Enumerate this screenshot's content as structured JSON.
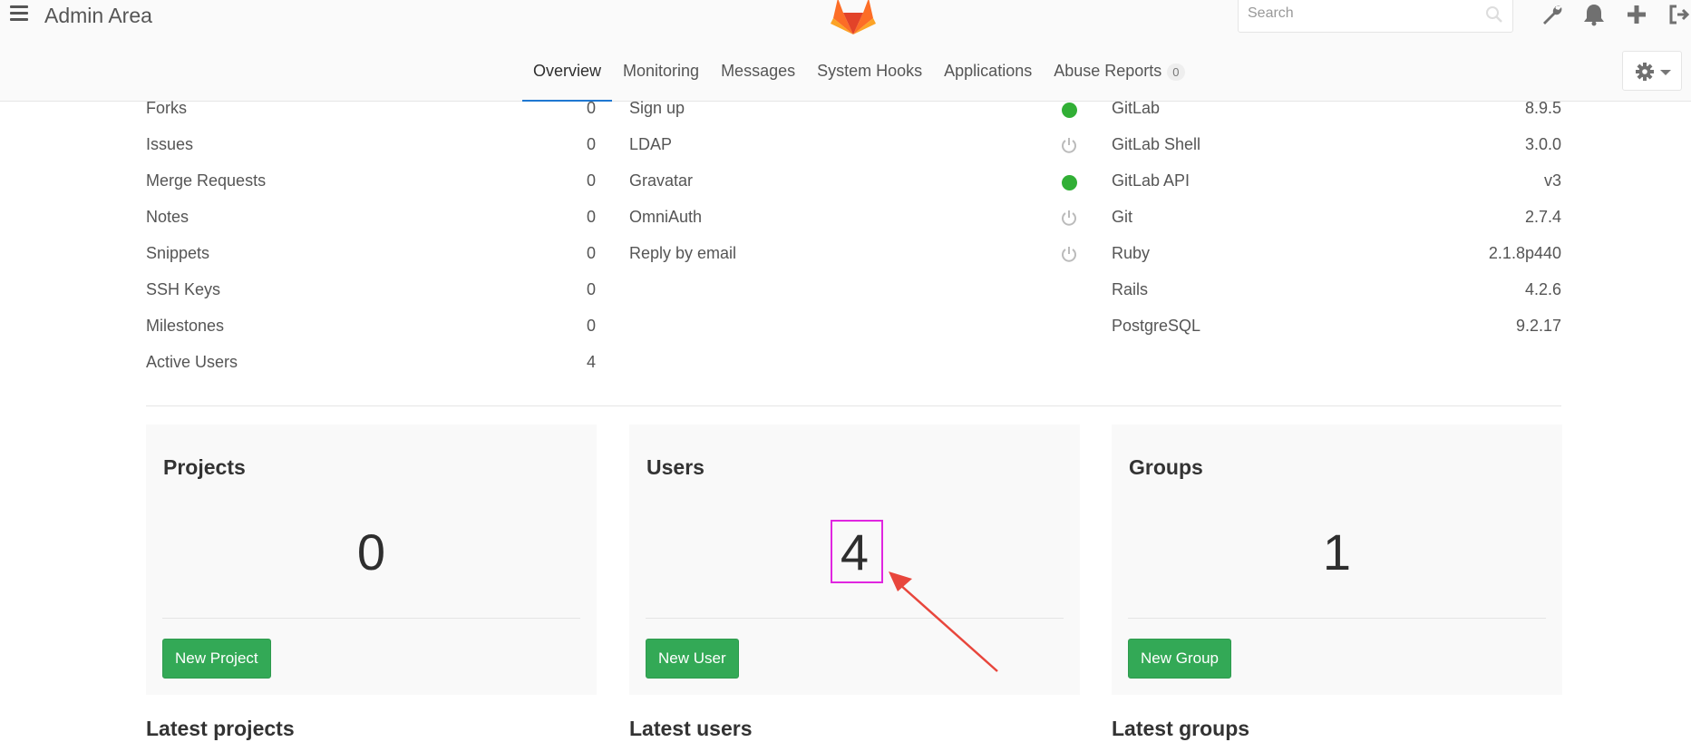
{
  "header": {
    "title": "Admin Area",
    "search_placeholder": "Search"
  },
  "nav": {
    "tabs": [
      {
        "label": "Overview",
        "active": true
      },
      {
        "label": "Monitoring"
      },
      {
        "label": "Messages"
      },
      {
        "label": "System Hooks"
      },
      {
        "label": "Applications"
      },
      {
        "label": "Abuse Reports",
        "badge": "0"
      }
    ]
  },
  "stats": [
    {
      "label": "Forks",
      "value": "0"
    },
    {
      "label": "Issues",
      "value": "0"
    },
    {
      "label": "Merge Requests",
      "value": "0"
    },
    {
      "label": "Notes",
      "value": "0"
    },
    {
      "label": "Snippets",
      "value": "0"
    },
    {
      "label": "SSH Keys",
      "value": "0"
    },
    {
      "label": "Milestones",
      "value": "0"
    },
    {
      "label": "Active Users",
      "value": "4"
    }
  ],
  "features": [
    {
      "label": "Sign up",
      "enabled": true
    },
    {
      "label": "LDAP",
      "enabled": false
    },
    {
      "label": "Gravatar",
      "enabled": true
    },
    {
      "label": "OmniAuth",
      "enabled": false
    },
    {
      "label": "Reply by email",
      "enabled": false
    }
  ],
  "components": [
    {
      "label": "GitLab",
      "value": "8.9.5"
    },
    {
      "label": "GitLab Shell",
      "value": "3.0.0"
    },
    {
      "label": "GitLab API",
      "value": "v3"
    },
    {
      "label": "Git",
      "value": "2.7.4"
    },
    {
      "label": "Ruby",
      "value": "2.1.8p440"
    },
    {
      "label": "Rails",
      "value": "4.2.6"
    },
    {
      "label": "PostgreSQL",
      "value": "9.2.17"
    }
  ],
  "boxes": {
    "projects": {
      "title": "Projects",
      "count": "0",
      "button": "New Project"
    },
    "users": {
      "title": "Users",
      "count": "4",
      "button": "New User"
    },
    "groups": {
      "title": "Groups",
      "count": "1",
      "button": "New Group"
    }
  },
  "sections": {
    "latest_projects": "Latest projects",
    "latest_users": "Latest users",
    "latest_groups": "Latest groups"
  },
  "colors": {
    "status_on": "#31af35",
    "button_green": "#33a956",
    "highlight": "#e026e0",
    "arrow": "#e8463c"
  }
}
